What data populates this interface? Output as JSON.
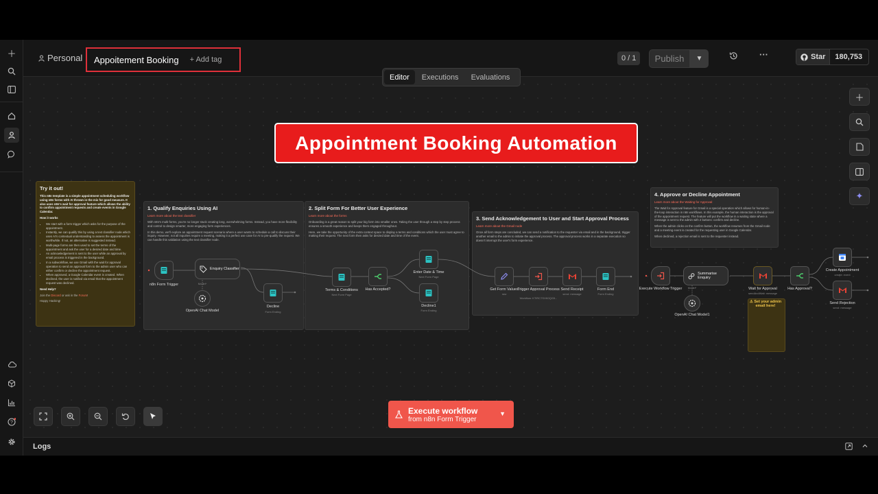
{
  "header": {
    "project": "Personal",
    "workflow_title": "Appoitement Booking",
    "add_tag": "+ Add tag",
    "version_count": "0 / 1",
    "publish": "Publish",
    "github_star": "Star",
    "github_count": "180,753"
  },
  "tabs": [
    {
      "label": "Editor",
      "active": true
    },
    {
      "label": "Executions",
      "active": false
    },
    {
      "label": "Evaluations",
      "active": false
    }
  ],
  "banner": "Appointment Booking Automation",
  "notes": {
    "try": {
      "title": "Try it out!",
      "intro": "This n8n template is a simple appointment scheduling workflow using n8n forms with AI thrown in the mix for good measure. It also uses n8n's wait for approval feature which allows the ability to confirm appointment requests and create events in Google Calendar.",
      "how": "How it works",
      "bullets": [
        "We start with a form trigger which asks for the purpose of the appointment.",
        "Instantly, we can qualify this by using a text classifier node which uses AI's contextual understanding to assess the appointment is worthwhile. If not, an alternative is suggested instead.",
        "Multi-page forms are then used to set the terms of the appointment and ask the user for a desired date and time.",
        "An acknowledgement is sent to the user while an approval by email process is triggered in the background.",
        "In a subworkflow, we use Gmail with the wait for approval operation to send an approval form to the admin user who can either confirm or decline the appointment request.",
        "When approved, a Google Calendar event is created. When declined, the user is notified via email that the appointment request was declined."
      ],
      "help": "Need Help?",
      "join_a": "Join the ",
      "discord": "Discord",
      "join_b": " or ask in the ",
      "forum": "Forum",
      "join_c": "!",
      "happy": "Happy Hacking!"
    },
    "s1": {
      "title": "1. Qualify Enquiries Using AI",
      "link": "Learn more about the text classifier",
      "p1": "With n8n's multi-forms, you're no longer stuck creating long, overwhelming forms. Instead, you have more flexibility and control to design smarter, more engaging form experiences.",
      "p2": "In this demo, we'll explore an appointment request scenario where a user wants to schedule a call to discuss their inquiry. However, not all inquiries require a meeting, making it a perfect use case for AI to pre-qualify the request. We can handle this validation using the text classifier node."
    },
    "s2": {
      "title": "2. Split Form For Better User Experience",
      "link": "Learn more about the forms",
      "p1": "Onboarding is a great reason to split your big form into smaller ones. Taking the user through a step by step process ensures a smooth experience and keeps them engaged throughout.",
      "p2": "Here, we take the opportunity of the extra context space to display a terms and conditions which the user must agree to making their request. The next form then asks for desired date and time of the event."
    },
    "s3": {
      "title": "3. Send Acknowledgement to User and Start Approval Process",
      "link": "Learn more about the Gmail node",
      "p1": "Once all form steps are concluded, we can send a notification to the requester via email and in the background, trigger another email to the admin to initiate the approval process. The approval process works in a separate execution so doesn't interrupt the user's form experience."
    },
    "s4": {
      "title": "4. Approve or Decline Appointment",
      "link": "Learn more about the Waiting for Approval",
      "p1": "The Wait for Approval feature for Gmail is a special operation which allows for human-in-the-loop interaction in n8n workflows. In this example, the human interaction is the approval of the appointment request. The feature will put the workflow in a waiting state where a message is sent to the admin with 2 buttons: confirm and decline.",
      "p2": "When the admin clicks on the confirm button, the workflow resumes from the Gmail node and a meeting event is created for the requesting user in Google Calendar.",
      "p3": "When declined, a rejection email is sent to the requester instead."
    }
  },
  "nodes": {
    "form_trigger": "n8n Form Trigger",
    "classifier": "Enquiry Classifier",
    "chat_model": "OpenAI Chat Model",
    "decline": "Decline",
    "decline_sub": "Form Ending",
    "terms": "Terms & Conditions",
    "terms_sub": "Next Form Page",
    "accepted": "Has Accepted?",
    "enter_date": "Enter Date & Time",
    "enter_date_sub": "Next Form Page",
    "decline1": "Decline1",
    "decline1_sub": "Form Ending",
    "get_values": "Get Form Values",
    "get_values_sub": "raw",
    "trigger_approval": "Trigger Approval Process",
    "trigger_approval_sub": "Workflow: KTIRC7SXK0QG5...",
    "send_receipt": "Send Receipt",
    "send_receipt_sub": "send: message",
    "form_end": "Form End",
    "form_end_sub": "Form Ending",
    "exec_trigger": "Execute Workflow Trigger",
    "summarise": "Summarise Enquiry",
    "chat_model1": "OpenAI Chat Model1",
    "wait_approval": "Wait for Approval",
    "wait_approval_sub": "sendAndWait: message",
    "wait_warn": "Set your admin email here!",
    "has_approval": "Has Approval?",
    "create_appt": "Create Appointment",
    "create_appt_sub": "create: event",
    "send_reject": "Send Rejection",
    "send_reject_sub": "send: message",
    "model_label": "Model*"
  },
  "execute": {
    "line1": "Execute workflow",
    "line2": "from n8n Form Trigger"
  },
  "logs": "Logs",
  "colors": {
    "accent": "#f0564b",
    "banner": "#e81c1c",
    "highlight_border": "#e0303a"
  }
}
